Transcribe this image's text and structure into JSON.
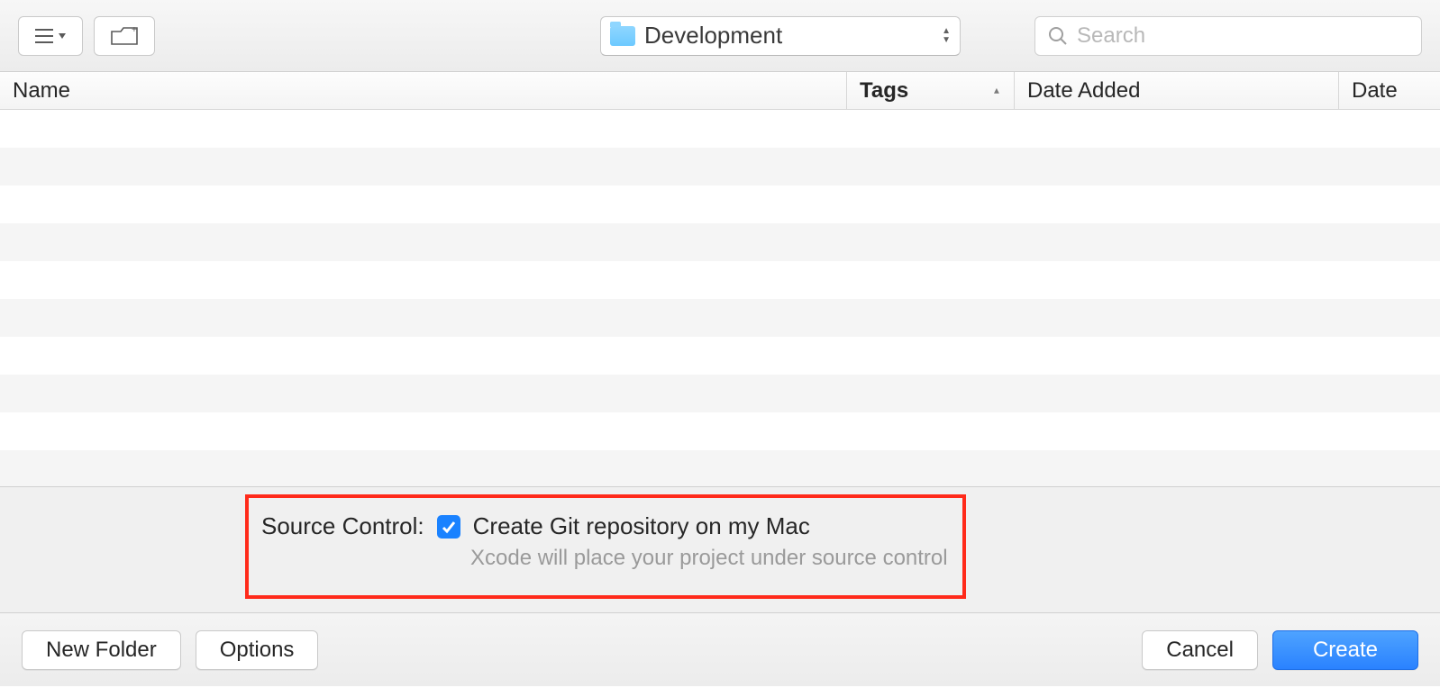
{
  "toolbar": {
    "path_label": "Development",
    "search_placeholder": "Search"
  },
  "columns": {
    "name": "Name",
    "tags": "Tags",
    "date_added": "Date Added",
    "date_modified": "Date "
  },
  "source_control": {
    "label": "Source Control:",
    "checkbox_label": "Create Git repository on my Mac",
    "subtitle": "Xcode will place your project under source control"
  },
  "footer": {
    "new_folder": "New Folder",
    "options": "Options",
    "cancel": "Cancel",
    "create": "Create"
  }
}
